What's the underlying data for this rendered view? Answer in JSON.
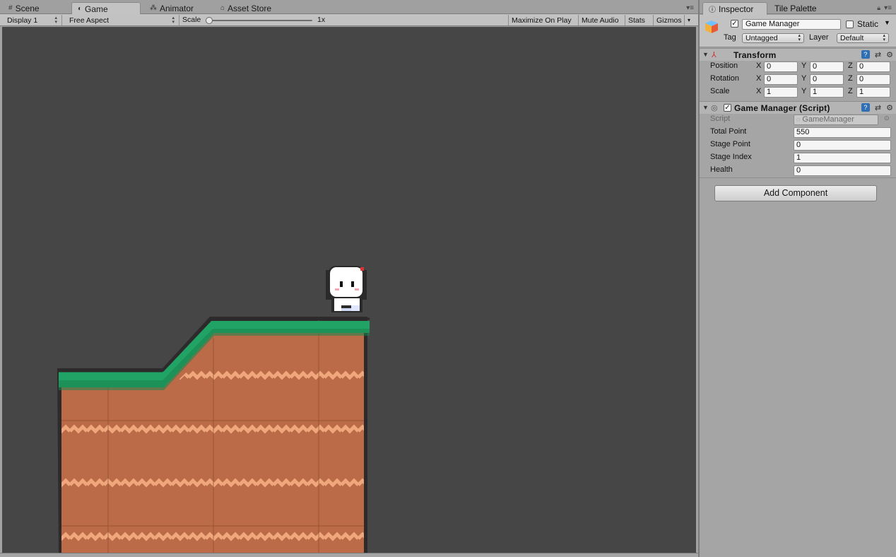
{
  "game_panel": {
    "tabs": [
      {
        "label": "Scene",
        "icon": "grid-icon"
      },
      {
        "label": "Game",
        "icon": "pacman-icon"
      },
      {
        "label": "Animator",
        "icon": "animator-icon"
      },
      {
        "label": "Asset Store",
        "icon": "store-icon"
      }
    ],
    "active_tab": "Game",
    "toolbar": {
      "display": "Display 1",
      "aspect": "Free Aspect",
      "scale_label": "Scale",
      "scale_value": "1x",
      "maximize_on_play": "Maximize On Play",
      "mute_audio": "Mute Audio",
      "stats": "Stats",
      "gizmos": "Gizmos"
    },
    "colors": {
      "background": "#464646",
      "grass": "#21a366",
      "dirt": "#bb6b47",
      "dirt_stripe": "#f0a77b"
    }
  },
  "inspector": {
    "tabs": [
      {
        "label": "Inspector",
        "icon": "info-icon"
      },
      {
        "label": "Tile Palette"
      }
    ],
    "object": {
      "name": "Game Manager",
      "active": true,
      "static_label": "Static",
      "static": false,
      "tag_label": "Tag",
      "tag": "Untagged",
      "layer_label": "Layer",
      "layer": "Default"
    },
    "transform": {
      "title": "Transform",
      "rows": [
        {
          "label": "Position",
          "x": "0",
          "y": "0",
          "z": "0"
        },
        {
          "label": "Rotation",
          "x": "0",
          "y": "0",
          "z": "0"
        },
        {
          "label": "Scale",
          "x": "1",
          "y": "1",
          "z": "1"
        }
      ],
      "axes": [
        "X",
        "Y",
        "Z"
      ]
    },
    "script_component": {
      "title": "Game Manager (Script)",
      "enabled": true,
      "script_label": "Script",
      "script_value": "GameManager",
      "fields": [
        {
          "label": "Total Point",
          "value": "550"
        },
        {
          "label": "Stage Point",
          "value": "0"
        },
        {
          "label": "Stage Index",
          "value": "1"
        },
        {
          "label": "Health",
          "value": "0"
        }
      ]
    },
    "add_component": "Add Component"
  }
}
